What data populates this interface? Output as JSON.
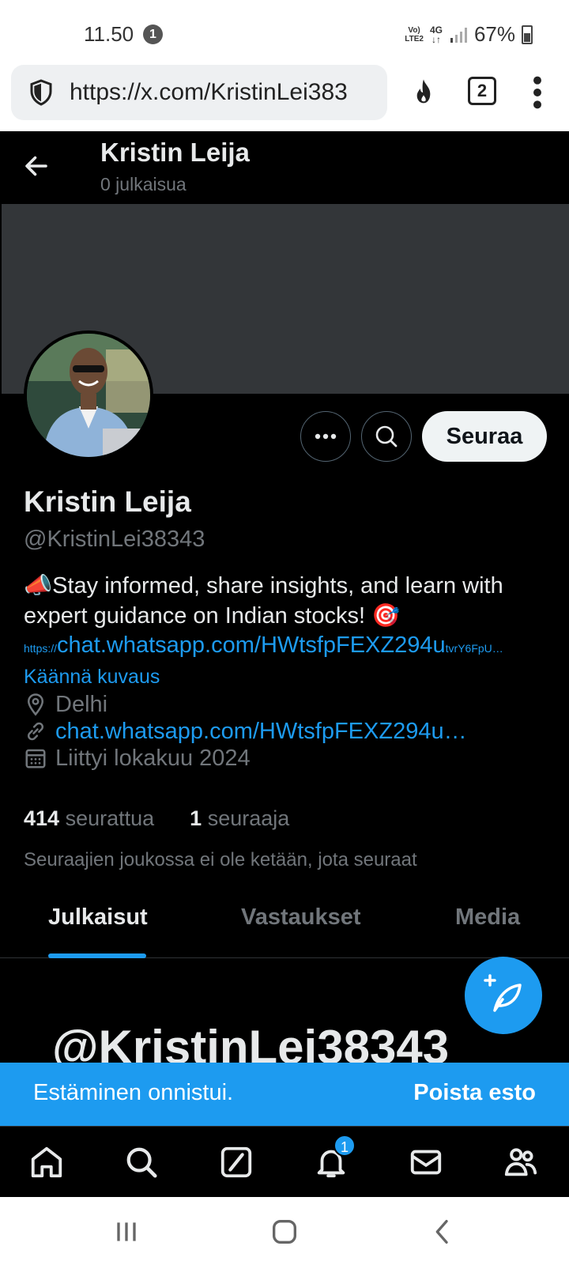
{
  "status_bar": {
    "time": "11.50",
    "notification_count": "1",
    "volte": "Vo)\nLTE2",
    "network": "4G",
    "battery": "67%"
  },
  "browser": {
    "url": "https://x.com/KristinLei383",
    "tab_count": "2"
  },
  "header": {
    "name": "Kristin Leija",
    "post_count": "0 julkaisua"
  },
  "profile": {
    "follow_label": "Seuraa",
    "name": "Kristin Leija",
    "handle": "@KristinLei38343",
    "bio": "📣Stay informed, share insights, and learn with expert guidance on Indian stocks! 🎯",
    "bio_link_prefix": "https://",
    "bio_link_main": "chat.whatsapp.com/HWtsfpFEXZ294u",
    "bio_link_suffix": "tvrY6FpU…",
    "translate_label": "Käännä kuvaus",
    "location": "Delhi",
    "website": "chat.whatsapp.com/HWtsfpFEXZ294u…",
    "joined": "Liittyi lokakuu 2024",
    "following_count": "414",
    "following_label": "seurattua",
    "followers_count": "1",
    "followers_label": "seuraaja",
    "mutual_text": "Seuraajien joukossa ei ole ketään, jota seuraat"
  },
  "tabs": [
    {
      "label": "Julkaisut",
      "active": true
    },
    {
      "label": "Vastaukset",
      "active": false
    },
    {
      "label": "Media",
      "active": false
    }
  ],
  "content": {
    "blocked_handle": "@KristinLei38343"
  },
  "toast": {
    "message": "Estäminen onnistui.",
    "action": "Poista esto"
  },
  "bottom_nav": {
    "notifications_badge": "1",
    "items": [
      "home-icon",
      "search-icon",
      "grok-icon",
      "notifications-icon",
      "messages-icon",
      "communities-icon"
    ]
  },
  "colors": {
    "accent": "#1d9bf0",
    "background": "#000000",
    "banner": "#333639",
    "secondary_text": "#71767b"
  }
}
